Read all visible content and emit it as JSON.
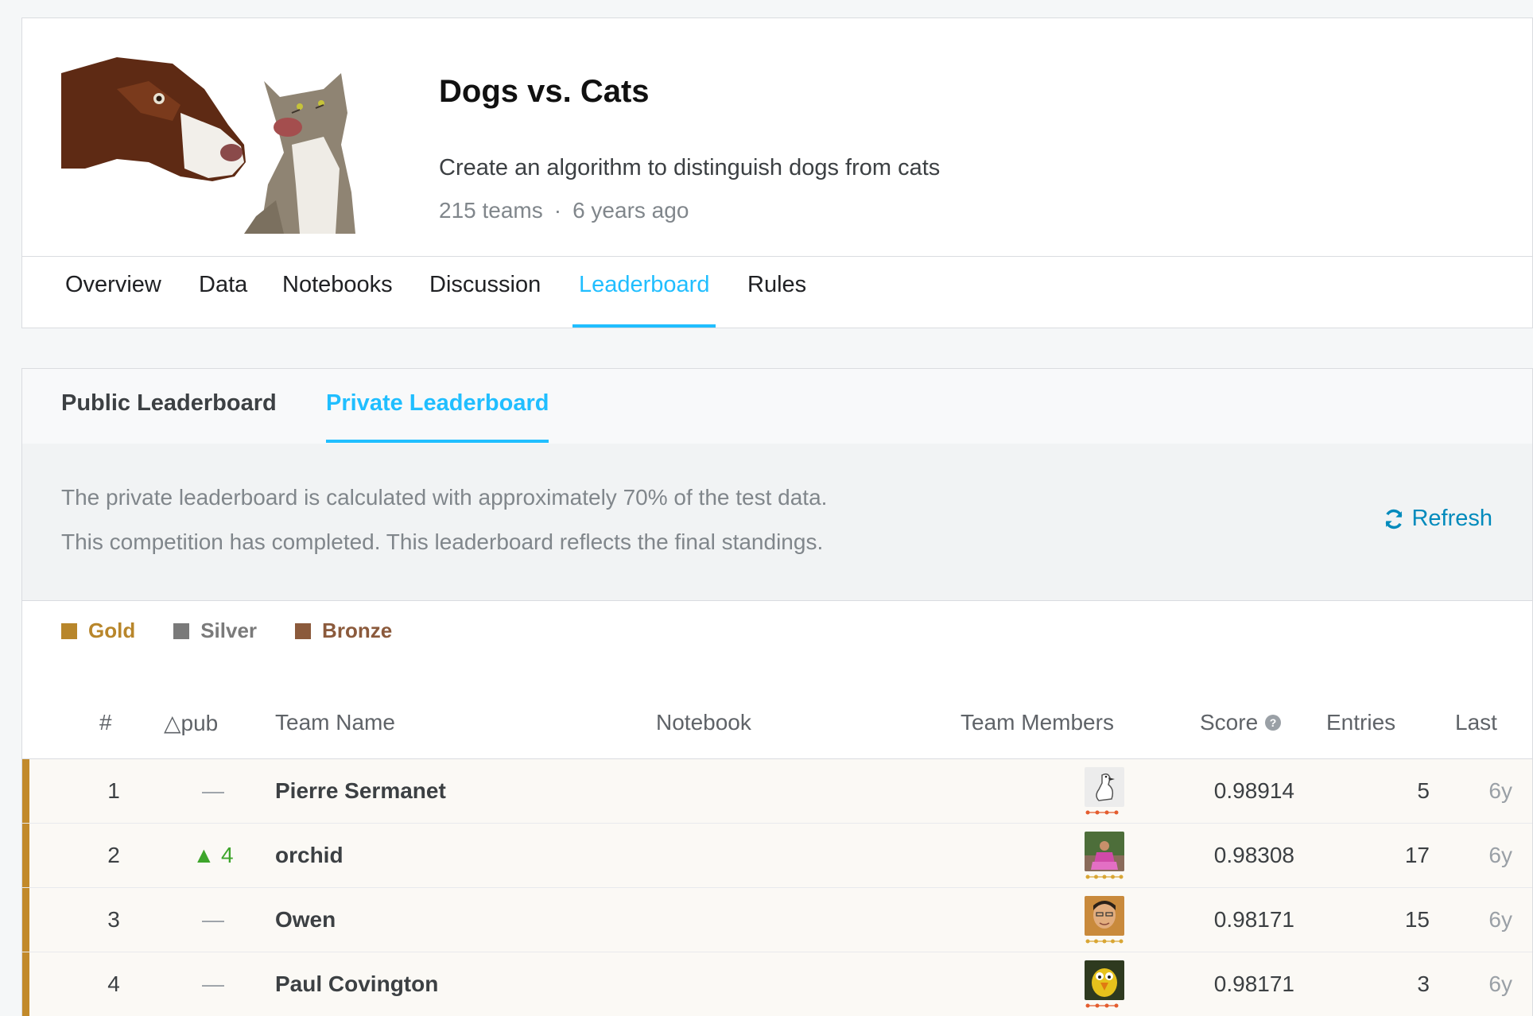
{
  "competition": {
    "title": "Dogs vs. Cats",
    "description": "Create an algorithm to distinguish dogs from cats",
    "teams": "215 teams",
    "separator": "·",
    "age": "6 years ago"
  },
  "nav": {
    "tabs": [
      "Overview",
      "Data",
      "Notebooks",
      "Discussion",
      "Leaderboard",
      "Rules"
    ],
    "active": "Leaderboard"
  },
  "leaderboard": {
    "tabs": [
      "Public Leaderboard",
      "Private Leaderboard"
    ],
    "active": "Private Leaderboard",
    "info_line_1": "The private leaderboard is calculated with approximately 70% of the test data.",
    "info_line_2": "This competition has completed. This leaderboard reflects the final standings.",
    "refresh_label": "Refresh",
    "legend": [
      {
        "label": "Gold",
        "color": "#b8862b"
      },
      {
        "label": "Silver",
        "color": "#7a7a7a"
      },
      {
        "label": "Bronze",
        "color": "#8b5a3c"
      }
    ],
    "columns": {
      "rank": "#",
      "delta": "△pub",
      "team": "Team Name",
      "notebook": "Notebook",
      "members": "Team Members",
      "score": "Score",
      "entries": "Entries",
      "last": "Last"
    },
    "rows": [
      {
        "rank": "1",
        "delta": "—",
        "team": "Pierre Sermanet",
        "score": "0.98914",
        "entries": "5",
        "last": "6y"
      },
      {
        "rank": "2",
        "delta": "▲ 4",
        "team": "orchid",
        "score": "0.98308",
        "entries": "17",
        "last": "6y"
      },
      {
        "rank": "3",
        "delta": "—",
        "team": "Owen",
        "score": "0.98171",
        "entries": "15",
        "last": "6y"
      },
      {
        "rank": "4",
        "delta": "—",
        "team": "Paul Covington",
        "score": "0.98171",
        "entries": "3",
        "last": "6y"
      }
    ]
  },
  "colors": {
    "accent": "#20beff",
    "link": "#008abc",
    "gold": "#c28a2b",
    "up": "#3ea52b"
  }
}
